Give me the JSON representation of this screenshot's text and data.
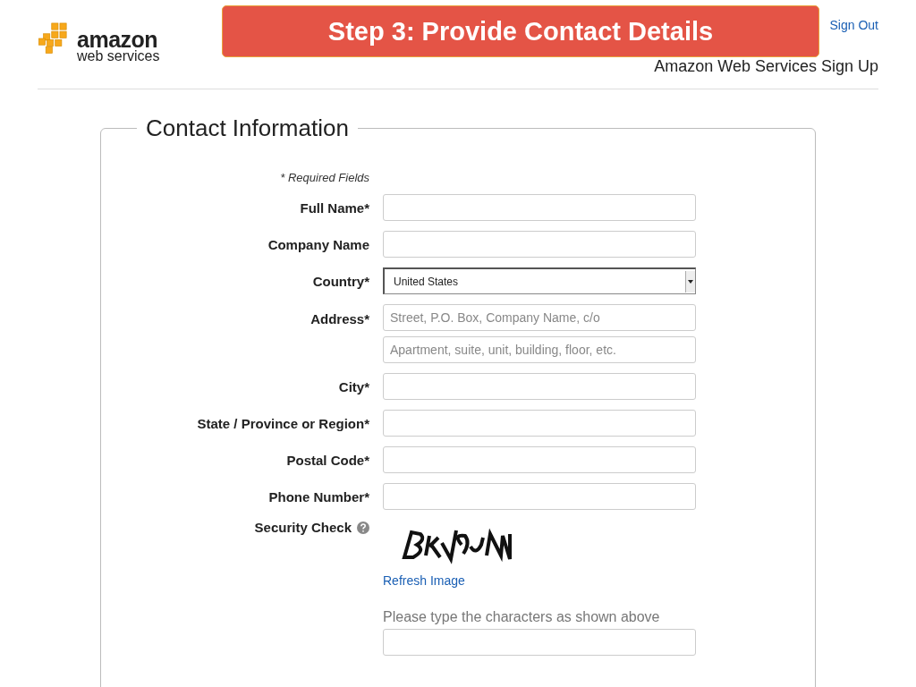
{
  "header": {
    "logo": {
      "word": "amazon",
      "subword": "web services"
    },
    "banner": "Step 3: Provide Contact Details",
    "sign_out": "Sign Out",
    "page_title": "Amazon Web Services Sign Up"
  },
  "form": {
    "legend": "Contact Information",
    "required_note": "* Required Fields",
    "fields": [
      {
        "label": "Full Name*",
        "kind": "text"
      },
      {
        "label": "Company Name",
        "kind": "text"
      },
      {
        "label": "Country*",
        "kind": "select",
        "value": "United States"
      },
      {
        "label": "Address*",
        "kind": "text",
        "placeholders": [
          "Street, P.O. Box, Company Name, c/o",
          "Apartment, suite, unit, building, floor, etc."
        ]
      },
      {
        "label": "City*",
        "kind": "text"
      },
      {
        "label": "State / Province or Region*",
        "kind": "text"
      },
      {
        "label": "Postal Code*",
        "kind": "text"
      },
      {
        "label": "Phone Number*",
        "kind": "text"
      }
    ],
    "security": {
      "label": "Security Check",
      "refresh_link": "Refresh Image",
      "prompt": "Please type the characters as shown above"
    }
  }
}
